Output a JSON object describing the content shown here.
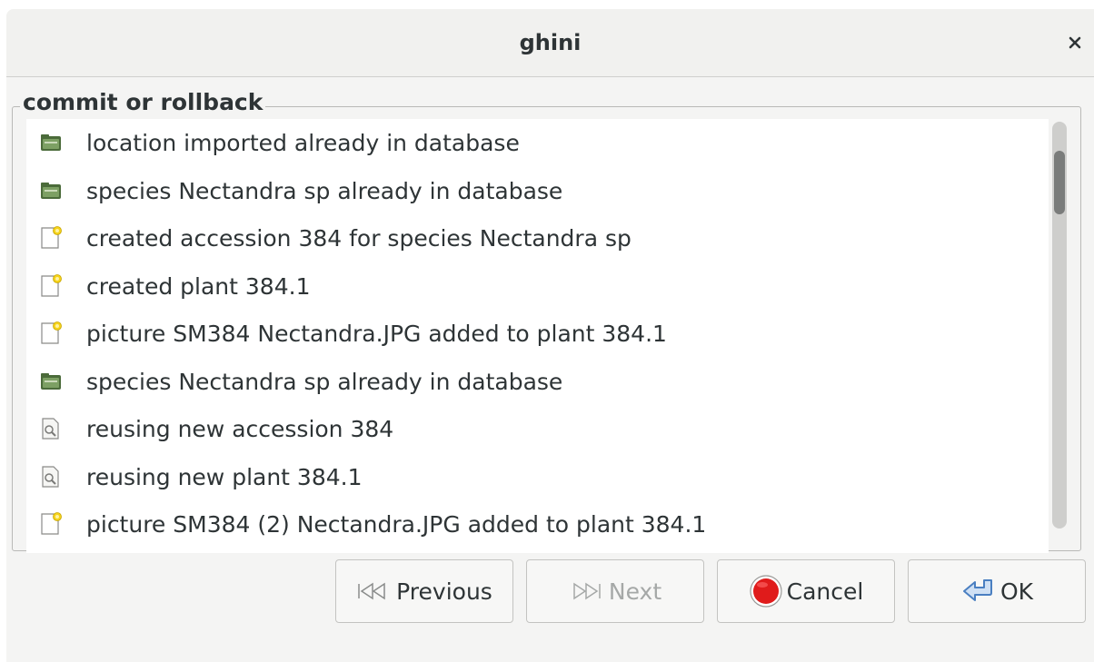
{
  "window": {
    "title": "ghini",
    "close_glyph": "×"
  },
  "frame": {
    "label": "commit or rollback"
  },
  "list": {
    "items": [
      {
        "icon": "folder-icon",
        "text": "location imported already in database"
      },
      {
        "icon": "folder-icon",
        "text": "species Nectandra sp already in database"
      },
      {
        "icon": "new-document-icon",
        "text": "created accession 384 for species Nectandra sp"
      },
      {
        "icon": "new-document-icon",
        "text": "created plant 384.1"
      },
      {
        "icon": "new-document-icon",
        "text": "picture SM384 Nectandra.JPG added to plant 384.1"
      },
      {
        "icon": "folder-icon",
        "text": "species Nectandra sp already in database"
      },
      {
        "icon": "document-search-icon",
        "text": "reusing new accession 384"
      },
      {
        "icon": "document-search-icon",
        "text": "reusing new plant 384.1"
      },
      {
        "icon": "new-document-icon",
        "text": "picture SM384 (2) Nectandra.JPG added to plant 384.1"
      }
    ]
  },
  "buttons": {
    "previous": "Previous",
    "next": "Next",
    "cancel": "Cancel",
    "ok": "OK"
  },
  "colors": {
    "folder": "#5d7a4a",
    "cancel_red": "#e01b1b",
    "ok_blue": "#4a7fc1"
  }
}
